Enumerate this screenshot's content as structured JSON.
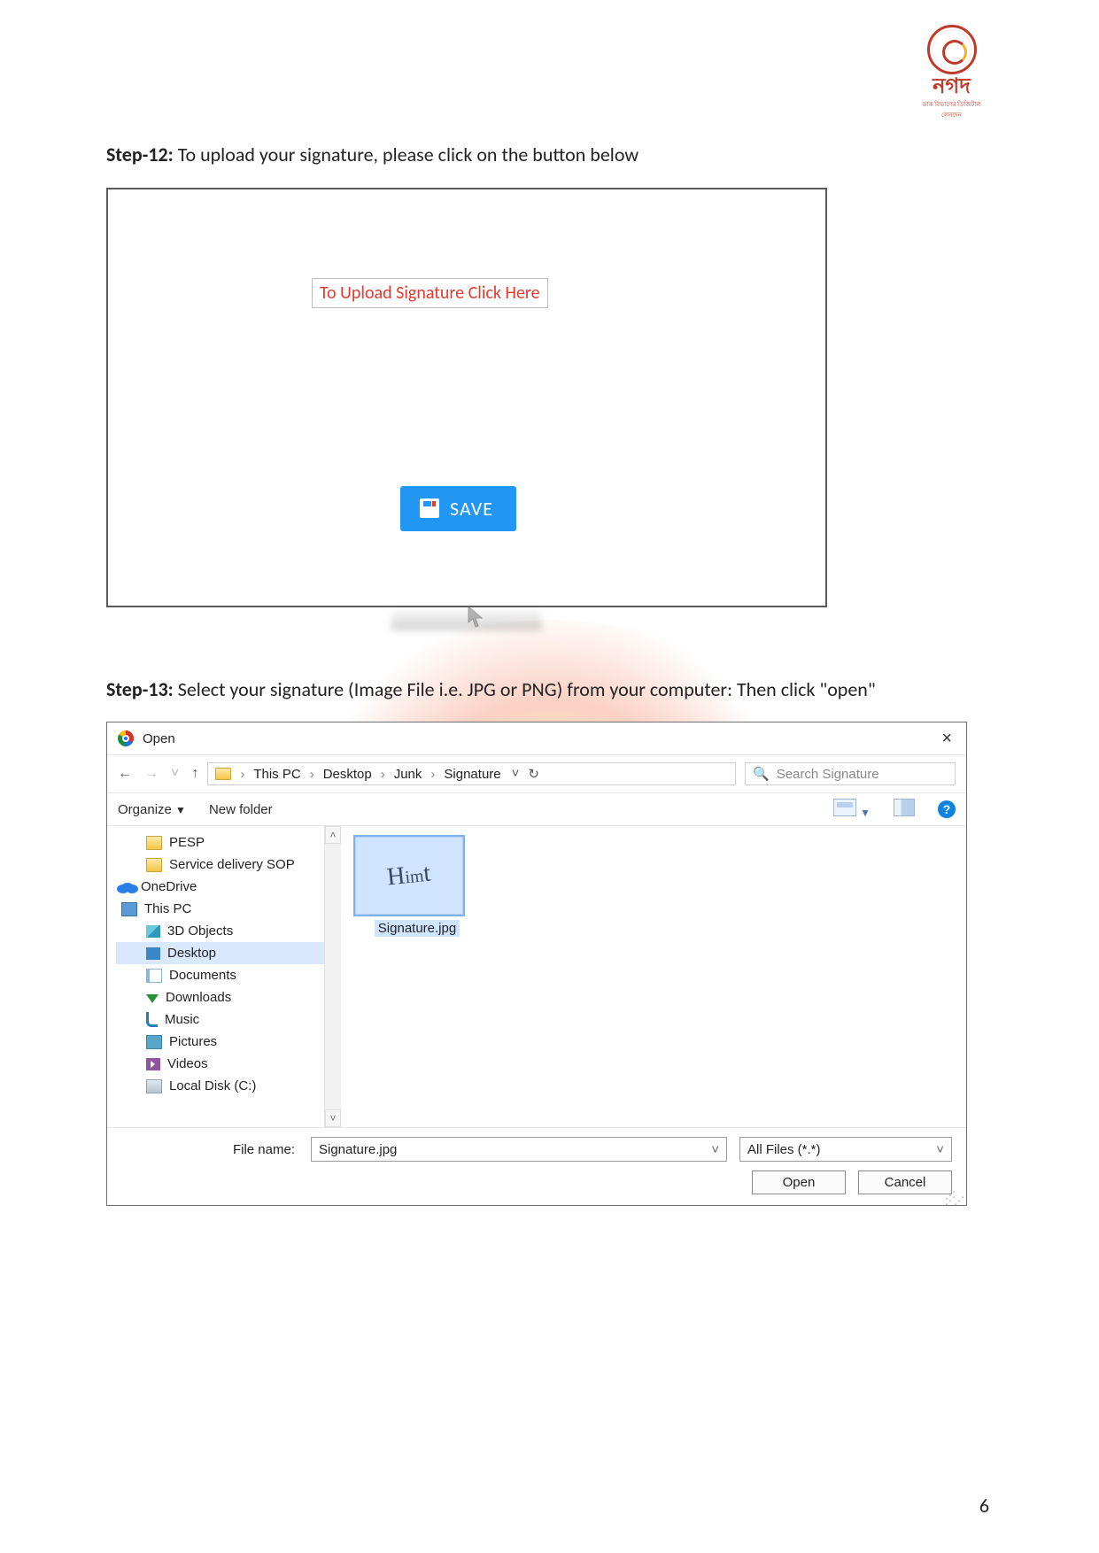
{
  "logo": {
    "brand_bn": "নগদ",
    "sub": "ডাক বিভাগের ডিজিটাল লেনদেন"
  },
  "step12": {
    "label": "Step-12:",
    "text": " To upload your signature, please click on the button below",
    "upload_button": "To Upload Signature Click Here",
    "save_button": "SAVE"
  },
  "step13": {
    "label": "Step-13:",
    "text": " Select your signature (Image File i.e. JPG or PNG) from your computer: Then click \"open\""
  },
  "dialog": {
    "title": "Open",
    "breadcrumb": [
      "This PC",
      "Desktop",
      "Junk",
      "Signature"
    ],
    "search_placeholder": "Search Signature",
    "toolbar": {
      "organize": "Organize",
      "new_folder": "New folder"
    },
    "tree": {
      "items": [
        {
          "label": "PESP",
          "icon": "folder",
          "indent": 1
        },
        {
          "label": "Service delivery SOP",
          "icon": "folder",
          "indent": 1
        },
        {
          "label": "OneDrive",
          "icon": "cloud",
          "indent": 0
        },
        {
          "label": "This PC",
          "icon": "pc",
          "indent": 0
        },
        {
          "label": "3D Objects",
          "icon": "cube",
          "indent": 1
        },
        {
          "label": "Desktop",
          "icon": "desk",
          "indent": 1,
          "selected": true
        },
        {
          "label": "Documents",
          "icon": "doc",
          "indent": 1
        },
        {
          "label": "Downloads",
          "icon": "down",
          "indent": 1
        },
        {
          "label": "Music",
          "icon": "music",
          "indent": 1
        },
        {
          "label": "Pictures",
          "icon": "pic",
          "indent": 1
        },
        {
          "label": "Videos",
          "icon": "vid",
          "indent": 1
        },
        {
          "label": "Local Disk (C:)",
          "icon": "disk",
          "indent": 1
        }
      ]
    },
    "files": {
      "selected_item": "Signature.jpg"
    },
    "footer": {
      "filename_label": "File name:",
      "filename_value": "Signature.jpg",
      "filter_value": "All Files (*.*)",
      "open": "Open",
      "cancel": "Cancel"
    }
  },
  "page_number": "6"
}
